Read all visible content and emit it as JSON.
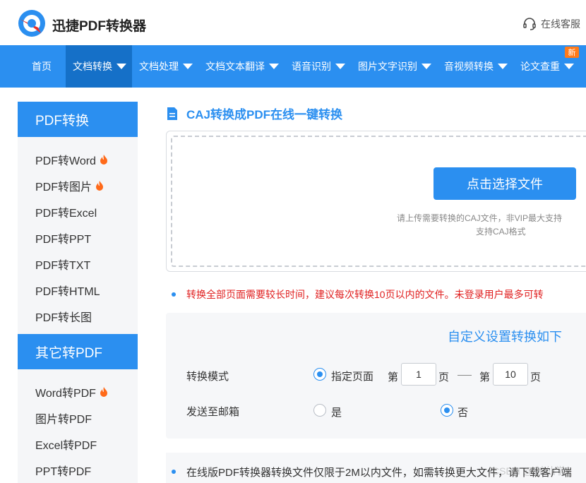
{
  "header": {
    "brand": "迅捷PDF转换器",
    "service": "在线客服"
  },
  "nav": {
    "items": [
      {
        "label": "首页"
      },
      {
        "label": "文档转换"
      },
      {
        "label": "文档处理"
      },
      {
        "label": "文档文本翻译"
      },
      {
        "label": "语音识别"
      },
      {
        "label": "图片文字识别"
      },
      {
        "label": "音视频转换"
      },
      {
        "label": "论文查重"
      }
    ],
    "badge": "新"
  },
  "sidebar": {
    "section1": "PDF转换",
    "section1_items": [
      "PDF转Word",
      "PDF转图片",
      "PDF转Excel",
      "PDF转PPT",
      "PDF转TXT",
      "PDF转HTML",
      "PDF转长图"
    ],
    "section2": "其它转PDF",
    "section2_items": [
      "Word转PDF",
      "图片转PDF",
      "Excel转PDF",
      "PPT转PDF"
    ]
  },
  "main": {
    "title": "CAJ转换成PDF在线一键转换",
    "upload_button": "点击选择文件",
    "hint_line1": "请上传需要转换的CAJ文件，非VIP最大支持",
    "hint_line2": "支持CAJ格式",
    "warning": "转换全部页面需要较长时间，建议每次转换10页以内的文件。未登录用户最多可转",
    "settings_title": "自定义设置转换如下",
    "mode_label": "转换模式",
    "mode_option": "指定页面",
    "page_prefix1": "第",
    "page_from": "1",
    "page_suffix1": "页",
    "page_prefix2": "第",
    "page_to": "10",
    "page_suffix2": "页",
    "email_label": "发送至邮箱",
    "email_yes": "是",
    "email_no": "否",
    "notice": "在线版PDF转换器转换文件仅限于2M以内文件，如需转换更大文件，请下载客户端",
    "watermark": "CSDN @ 神仙学"
  },
  "colors": {
    "accent": "#2b8ff0",
    "nav_active": "#1570c8",
    "warning": "#e02020",
    "badge": "#ff7a1a"
  }
}
